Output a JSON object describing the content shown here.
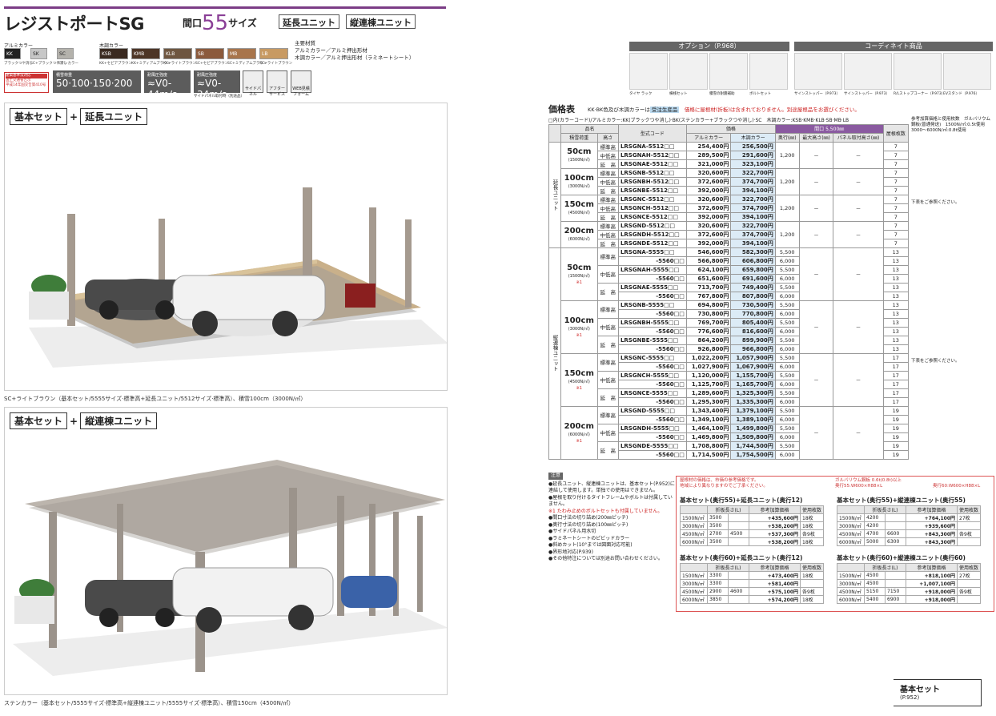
{
  "header": {
    "title": "レジストポートSG",
    "frontage_prefix": "間口",
    "frontage_num": "55",
    "frontage_suffix": "サイズ",
    "tags": [
      "延長ユニット",
      "縦連棟ユニット"
    ]
  },
  "colors": {
    "alumi_head": "アルミカラー",
    "wood_head": "木調カラー",
    "alumi": [
      {
        "code": "KK",
        "name": "ブラックつや消し",
        "hex": "#222222"
      },
      {
        "code": "SK",
        "name": "SC+ブラックつや消し",
        "hex": "#c7c7c7"
      },
      {
        "code": "SC",
        "name": "ステンカラー",
        "hex": "#b4b2ac"
      }
    ],
    "wood": [
      {
        "code": "KSB",
        "name": "KK+セピアブラウン",
        "hex": "#3a2a20"
      },
      {
        "code": "KMB",
        "name": "KK+ミディアムブラウン",
        "hex": "#4d3526"
      },
      {
        "code": "KLB",
        "name": "KK+ライトブラウン",
        "hex": "#6e5640"
      },
      {
        "code": "SB",
        "name": "SC+セピアブラウン",
        "hex": "#8b5a3c"
      },
      {
        "code": "MB",
        "name": "SC+ミディアムブラウン",
        "hex": "#a8754c"
      },
      {
        "code": "LB",
        "name": "SC+ライトブラウン",
        "hex": "#c89a62"
      }
    ],
    "material": [
      "主要材質",
      "アルミカラー／アルミ押出形材",
      "木調カラー／アルミ押出形材（ラミネートシート）"
    ]
  },
  "specs": {
    "red_box": [
      "建築基準法対応",
      "国土交通省告示",
      "平成14年国交告第410号"
    ],
    "snow": {
      "label": "積雪荷重",
      "value": "50·100·150·200㎝"
    },
    "wind1": {
      "label": "耐風圧強度",
      "value": "≈V0-44m/s"
    },
    "wind2": {
      "label": "耐風圧強度",
      "value": "≈V0-34m/s",
      "sub": "サイドパネル取付時（別途品）"
    },
    "icons": [
      "サイドパネル",
      "アフターサービス",
      "WEB見積フォーム"
    ]
  },
  "photos": [
    {
      "combo": [
        "基本セット",
        "+",
        "延長ユニット"
      ],
      "caption": "SC+ライトブラウン（基本セット/5555サイズ·標準高+延長ユニット/5512サイズ·標準高）、積雪100cm（3000N/㎡）"
    },
    {
      "combo": [
        "基本セット",
        "+",
        "縦連棟ユニット"
      ],
      "caption": "ステンカラー（基本セット/5555サイズ·標準高+縦連棟ユニット/5555サイズ·標準高）、積雪150cm（4500N/㎡）"
    }
  ],
  "options": {
    "option_head": "オプション（P.968）",
    "coord_head": "コーディネイト商品",
    "option_items": [
      "タイヤ ラック",
      "横桟セット",
      "積雪の耐震補助",
      "ボルトセット"
    ],
    "coord_items": [
      "サインストッパー（P.973）",
      "サインストッパー（P.973）",
      "R/Lストップコーナー（P.973）",
      "EVスタンド（P.976）"
    ]
  },
  "price": {
    "title": "価格表",
    "note_a": "KK·BK色及び木調カラーは",
    "note_badge": "受注生産品",
    "note_red": "価格に屋根材(折板)は含まれておりません。別途屋根品をお選びください。",
    "color_code": "□内(カラーコード)/アルミカラー:KK(ブラックつや消し)·BK(ステンカラー+ブラックつや消し)·SC　木調カラー:KSB·KMB·KLB·SB·MB·LB",
    "headers": {
      "hinmei": "品名",
      "snow": "積雪荷重",
      "height": "高さ",
      "code": "型式コード",
      "price": "価格",
      "alumi": "アルミカラー",
      "wood": "木調カラー",
      "frontage": "間口 5,500㎜",
      "depth": "奥行(㎜)",
      "maxh": "最大高さ(㎜)",
      "panel": "パネル取付高さ(㎜)",
      "sheets": "屋根枚数"
    },
    "group_ext": "延長ユニット",
    "group_tate": "縦連棟ユニット",
    "h_std": "標準高",
    "h_mid": "中低高",
    "h_ext": "延長",
    "dash": "－",
    "ext_side": "下表をご参照ください。",
    "ext_side_top": "参考加算価格と使用枚数　ガルバリウム鋼板(普通発送)　1500N/㎡:0.5t使用　3000～6000N/㎡:0.8t使用",
    "ext": [
      {
        "snow": "50cm",
        "snow_sub": "(1500N/㎡)",
        "depth": "1,200",
        "rows": [
          {
            "h": "標準高",
            "code": "LRSGNA-5512□□",
            "a": "254,400円",
            "w": "256,500円",
            "s": "7"
          },
          {
            "h": "中低高",
            "code": "LRSGNAH-5512□□",
            "a": "289,500円",
            "w": "291,600円",
            "s": "7"
          },
          {
            "h": "延　高",
            "code": "LRSGNAE-5512□□",
            "a": "321,000円",
            "w": "323,100円",
            "s": "7"
          }
        ]
      },
      {
        "snow": "100cm",
        "snow_sub": "(3000N/㎡)",
        "depth": "1,200",
        "rows": [
          {
            "h": "標準高",
            "code": "LRSGNB-5512□□",
            "a": "320,600円",
            "w": "322,700円",
            "s": "7"
          },
          {
            "h": "中低高",
            "code": "LRSGNBH-5512□□",
            "a": "372,600円",
            "w": "374,700円",
            "s": "7"
          },
          {
            "h": "延　高",
            "code": "LRSGNBE-5512□□",
            "a": "392,000円",
            "w": "394,100円",
            "s": "7"
          }
        ]
      },
      {
        "snow": "150cm",
        "snow_sub": "(4500N/㎡)",
        "depth": "1,200",
        "rows": [
          {
            "h": "標準高",
            "code": "LRSGNC-5512□□",
            "a": "320,600円",
            "w": "322,700円",
            "s": "7"
          },
          {
            "h": "中低高",
            "code": "LRSGNCH-5512□□",
            "a": "372,600円",
            "w": "374,700円",
            "s": "7"
          },
          {
            "h": "延　高",
            "code": "LRSGNCE-5512□□",
            "a": "392,000円",
            "w": "394,100円",
            "s": "7"
          }
        ]
      },
      {
        "snow": "200cm",
        "snow_sub": "(6000N/㎡)",
        "depth": "1,200",
        "rows": [
          {
            "h": "標準高",
            "code": "LRSGND-5512□□",
            "a": "320,600円",
            "w": "322,700円",
            "s": "7"
          },
          {
            "h": "中低高",
            "code": "LRSGNDH-5512□□",
            "a": "372,600円",
            "w": "374,700円",
            "s": "7"
          },
          {
            "h": "延　高",
            "code": "LRSGNDE-5512□□",
            "a": "392,000円",
            "w": "394,100円",
            "s": "7"
          }
        ]
      }
    ],
    "tate": [
      {
        "snow": "50cm",
        "snow_sub": "(1500N/㎡)",
        "mark": "※1",
        "rows": [
          {
            "h": "標準高",
            "code": "LRSGNA-5555□□",
            "a": "546,600円",
            "w": "582,300円",
            "d": "5,500",
            "s": "13"
          },
          {
            "h": "",
            "code": "-5560□□",
            "a": "566,800円",
            "w": "606,800円",
            "d": "6,000",
            "s": "13"
          },
          {
            "h": "中低高",
            "code": "LRSGNAH-5555□□",
            "a": "624,100円",
            "w": "659,800円",
            "d": "5,500",
            "s": "13"
          },
          {
            "h": "",
            "code": "-5560□□",
            "a": "651,600円",
            "w": "691,600円",
            "d": "6,000",
            "s": "13"
          },
          {
            "h": "延　高",
            "code": "LRSGNAE-5555□□",
            "a": "713,700円",
            "w": "749,400円",
            "d": "5,500",
            "s": "13"
          },
          {
            "h": "",
            "code": "-5560□□",
            "a": "767,800円",
            "w": "807,800円",
            "d": "6,000",
            "s": "13"
          }
        ]
      },
      {
        "snow": "100cm",
        "snow_sub": "(3000N/㎡)",
        "mark": "※1",
        "rows": [
          {
            "h": "標準高",
            "code": "LRSGNB-5555□□",
            "a": "694,800円",
            "w": "730,500円",
            "d": "5,500",
            "s": "13"
          },
          {
            "h": "",
            "code": "-5560□□",
            "a": "730,800円",
            "w": "770,800円",
            "d": "6,000",
            "s": "13"
          },
          {
            "h": "中低高",
            "code": "LRSGNBH-5555□□",
            "a": "769,700円",
            "w": "805,400円",
            "d": "5,500",
            "s": "13"
          },
          {
            "h": "",
            "code": "-5560□□",
            "a": "776,600円",
            "w": "816,600円",
            "d": "6,000",
            "s": "13"
          },
          {
            "h": "延　高",
            "code": "LRSGNBE-5555□□",
            "a": "864,200円",
            "w": "899,900円",
            "d": "5,500",
            "s": "13"
          },
          {
            "h": "",
            "code": "-5560□□",
            "a": "926,800円",
            "w": "966,800円",
            "d": "6,000",
            "s": "13"
          }
        ]
      },
      {
        "snow": "150cm",
        "snow_sub": "(4500N/㎡)",
        "mark": "※1",
        "rows": [
          {
            "h": "標準高",
            "code": "LRSGNC-5555□□",
            "a": "1,022,200円",
            "w": "1,057,900円",
            "d": "5,500",
            "s": "17"
          },
          {
            "h": "",
            "code": "-5560□□",
            "a": "1,027,900円",
            "w": "1,067,900円",
            "d": "6,000",
            "s": "17"
          },
          {
            "h": "中低高",
            "code": "LRSGNCH-5555□□",
            "a": "1,120,000円",
            "w": "1,155,700円",
            "d": "5,500",
            "s": "17"
          },
          {
            "h": "",
            "code": "-5560□□",
            "a": "1,125,700円",
            "w": "1,165,700円",
            "d": "6,000",
            "s": "17"
          },
          {
            "h": "延　高",
            "code": "LRSGNCE-5555□□",
            "a": "1,289,600円",
            "w": "1,325,300円",
            "d": "5,500",
            "s": "17"
          },
          {
            "h": "",
            "code": "-5560□□",
            "a": "1,295,300円",
            "w": "1,335,300円",
            "d": "6,000",
            "s": "17"
          }
        ]
      },
      {
        "snow": "200cm",
        "snow_sub": "(6000N/㎡)",
        "mark": "※1",
        "rows": [
          {
            "h": "標準高",
            "code": "LRSGND-5555□□",
            "a": "1,343,400円",
            "w": "1,379,100円",
            "d": "5,500",
            "s": "19"
          },
          {
            "h": "",
            "code": "-5560□□",
            "a": "1,349,100円",
            "w": "1,389,100円",
            "d": "6,000",
            "s": "19"
          },
          {
            "h": "中低高",
            "code": "LRSGNDH-5555□□",
            "a": "1,464,100円",
            "w": "1,499,800円",
            "d": "5,500",
            "s": "19"
          },
          {
            "h": "",
            "code": "-5560□□",
            "a": "1,469,800円",
            "w": "1,509,800円",
            "d": "6,000",
            "s": "19"
          },
          {
            "h": "延　高",
            "code": "LRSGNDE-5555□□",
            "a": "1,708,800円",
            "w": "1,744,500円",
            "d": "5,500",
            "s": "19"
          },
          {
            "h": "",
            "code": "-5560□□",
            "a": "1,714,500円",
            "w": "1,754,500円",
            "d": "6,000",
            "s": "19"
          }
        ]
      }
    ]
  },
  "notes": {
    "head": "注意",
    "items": [
      "●延長ユニット、縦連棟ユニットは、基本セット(P.952)に連結して使用します。単独での使用はできません。",
      "●屋根を取り付けるタイトフレームやボルトは付属していません。",
      "※1 たわみ止めのボルトセットも付属していません。",
      "●間口寸法の切り詰め(200㎜ピッチ)",
      "●奥行寸法の切り詰め(100㎜ピッチ)",
      "●サイドパネル用水切",
      "●ラミネートシートのピビッドカラー",
      "●斜めカット(10°までは図面対応可能)",
      "●界形地対応(P.939)",
      "●その他特注については別途お問い合わせください。"
    ]
  },
  "subtables": {
    "note_left": [
      "屋根材の価格は、市価の参考価格です。",
      "地域により異なりますのでご了承ください。"
    ],
    "note_right": [
      "ガルバリウム鋼板 0.6t(0.8t)以上",
      "奥行55:W600×H88×L",
      "奥行60:W600×H88×L"
    ],
    "cols": [
      "折板長さ(L)",
      "参考加算価格",
      "使用枚数"
    ],
    "t1": {
      "title": "基本セット(奥行55)+延長ユニット(奥行12)",
      "rows": [
        [
          "1500N/㎡",
          "3500",
          "",
          "+435,600円",
          "18枚"
        ],
        [
          "3000N/㎡",
          "3500",
          "",
          "+538,200円",
          "18枚"
        ],
        [
          "4500N/㎡",
          "2700",
          "4500",
          "+537,300円",
          "各9枚"
        ],
        [
          "6000N/㎡",
          "3500",
          "",
          "+538,200円",
          "18枚"
        ]
      ]
    },
    "t2": {
      "title": "基本セット(奥行55)+縦連棟ユニット(奥行55)",
      "rows": [
        [
          "1500N/㎡",
          "4200",
          "",
          "+764,100円",
          "27枚"
        ],
        [
          "3000N/㎡",
          "4200",
          "",
          "+939,600円",
          ""
        ],
        [
          "4500N/㎡",
          "4700",
          "6600",
          "+843,300円",
          "各9枚"
        ],
        [
          "6000N/㎡",
          "5000",
          "6300",
          "+843,300円",
          ""
        ]
      ]
    },
    "t3": {
      "title": "基本セット(奥行60)+延長ユニット(奥行12)",
      "rows": [
        [
          "1500N/㎡",
          "3300",
          "",
          "+473,400円",
          "18枚"
        ],
        [
          "3000N/㎡",
          "3300",
          "",
          "+581,400円",
          ""
        ],
        [
          "4500N/㎡",
          "2900",
          "4600",
          "+575,100円",
          "各9枚"
        ],
        [
          "6000N/㎡",
          "3850",
          "",
          "+574,200円",
          "18枚"
        ]
      ]
    },
    "t4": {
      "title": "基本セット(奥行60)+縦連棟ユニット(奥行60)",
      "rows": [
        [
          "1500N/㎡",
          "4500",
          "",
          "+818,100円",
          "27枚"
        ],
        [
          "3000N/㎡",
          "4500",
          "",
          "+1,007,100円",
          ""
        ],
        [
          "4500N/㎡",
          "5150",
          "7150",
          "+918,000円",
          "各9枚"
        ],
        [
          "6000N/㎡",
          "5400",
          "6900",
          "+918,000円",
          ""
        ]
      ]
    }
  },
  "bottom_ref": {
    "label": "基本セット",
    "page": "(P.952)"
  }
}
